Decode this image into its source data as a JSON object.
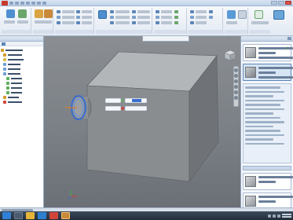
{
  "colors": {
    "accent": "#5b86b8",
    "model_face_front": "#8a8d90",
    "model_face_top": "#b3b6b9",
    "model_face_side": "#6f7276",
    "highlight_circle": "#3b6fd1",
    "viewport_bg": "#7d8287"
  },
  "icons": [
    "app-menu-icon",
    "filter-icon",
    "viewcube-icon",
    "orbit-icon",
    "pan-icon",
    "zoom-icon",
    "coordinate-axis-icon",
    "checkmark-icon",
    "pin-icon",
    "start-menu-icon",
    "folder-icon",
    "browser-icon",
    "acrobat-icon",
    "app-icon"
  ],
  "tree": [
    {
      "level": 0,
      "icon": "part-icon",
      "color": "#d69a2a"
    },
    {
      "level": 1,
      "icon": "view-icon",
      "color": "#d69a2a"
    },
    {
      "level": 1,
      "icon": "origin-icon",
      "color": "#e0b64a"
    },
    {
      "level": 1,
      "icon": "extrude-icon",
      "color": "#6f9fd6"
    },
    {
      "level": 1,
      "icon": "extrude-icon",
      "color": "#6f9fd6"
    },
    {
      "level": 1,
      "icon": "extrude-icon",
      "color": "#6f9fd6"
    },
    {
      "level": 2,
      "icon": "sketch-icon",
      "color": "#5bb05b"
    },
    {
      "level": 2,
      "icon": "sketch-icon",
      "color": "#5bb05b"
    },
    {
      "level": 2,
      "icon": "sketch-icon",
      "color": "#5bb05b"
    },
    {
      "level": 2,
      "icon": "sketch-icon",
      "color": "#5bb05b"
    },
    {
      "level": 1,
      "icon": "work-feature-icon",
      "color": "#d69a2a"
    },
    {
      "level": 1,
      "icon": "end-of-part-icon",
      "color": "#d0463a"
    }
  ],
  "steps": [
    {
      "state": "done",
      "check": "✓"
    },
    {
      "state": "active"
    }
  ]
}
